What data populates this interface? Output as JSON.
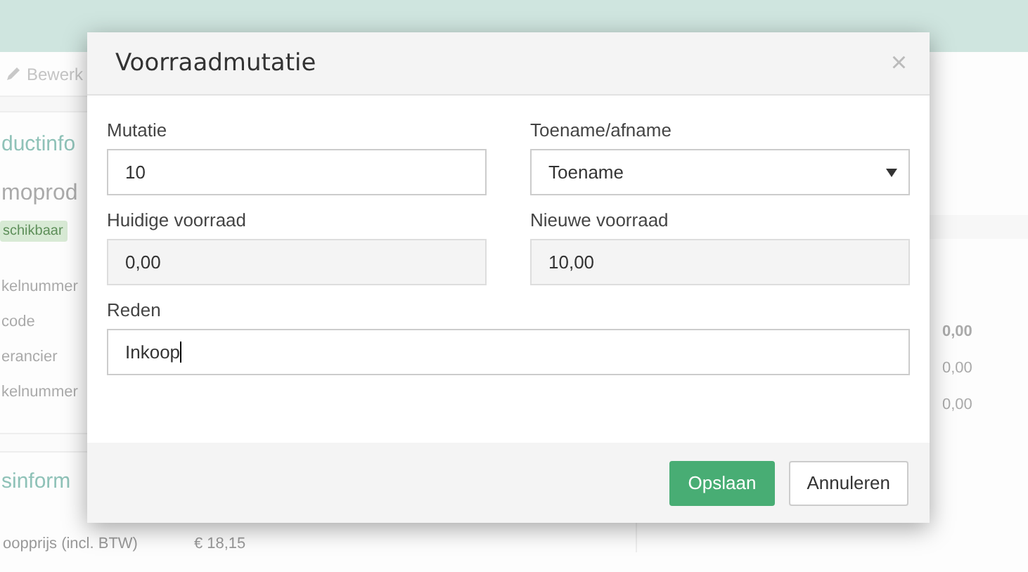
{
  "background": {
    "edit_button": "Bewerk",
    "section_title": "ductinfo",
    "product_name": "moprod",
    "badge": "schikbaar",
    "field_labels": [
      "kelnummer",
      "code",
      "erancier",
      "kelnummer"
    ],
    "section_title_2": "sinform",
    "price_label": "oopprijs (incl. BTW)",
    "price_value": "€ 18,15",
    "values": [
      {
        "text": "0,00",
        "bold": true
      },
      {
        "text": "0,00",
        "bold": false
      },
      {
        "text": "0,00",
        "bold": false
      }
    ]
  },
  "modal": {
    "title": "Voorraadmutatie",
    "close": "×",
    "fields": [
      {
        "label": "Mutatie",
        "value": "10",
        "kind": "input"
      },
      {
        "label": "Toename/afname",
        "value": "Toename",
        "kind": "select"
      },
      {
        "label": "Huidige voorraad",
        "value": "0,00",
        "kind": "readonly"
      },
      {
        "label": "Nieuwe voorraad",
        "value": "10,00",
        "kind": "readonly"
      },
      {
        "label": "Reden",
        "value": "Inkoop",
        "kind": "focused"
      }
    ],
    "buttons": [
      {
        "label": "Opslaan",
        "kind": "primary"
      },
      {
        "label": "Annuleren",
        "kind": "default"
      }
    ]
  }
}
